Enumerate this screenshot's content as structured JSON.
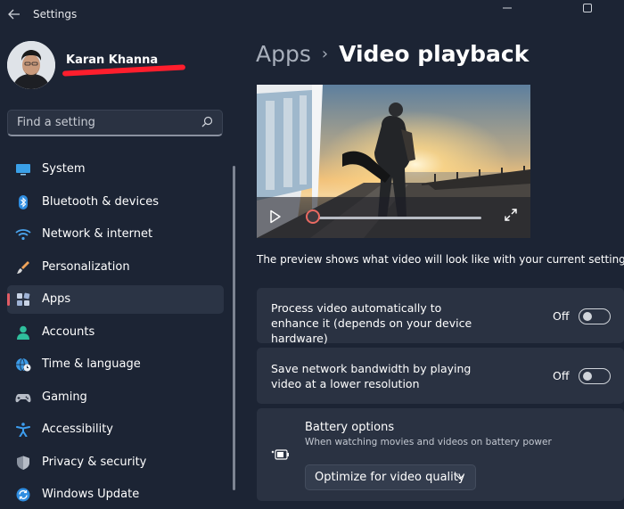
{
  "window": {
    "title": "Settings"
  },
  "profile": {
    "name": "Karan Khanna"
  },
  "search": {
    "placeholder": "Find a setting"
  },
  "sidebar": {
    "items": [
      {
        "label": "System",
        "icon": "monitor-icon",
        "active": false
      },
      {
        "label": "Bluetooth & devices",
        "icon": "bluetooth-icon",
        "active": false
      },
      {
        "label": "Network & internet",
        "icon": "wifi-icon",
        "active": false
      },
      {
        "label": "Personalization",
        "icon": "brush-icon",
        "active": false
      },
      {
        "label": "Apps",
        "icon": "apps-icon",
        "active": true
      },
      {
        "label": "Accounts",
        "icon": "person-icon",
        "active": false
      },
      {
        "label": "Time & language",
        "icon": "globe-clock-icon",
        "active": false
      },
      {
        "label": "Gaming",
        "icon": "controller-icon",
        "active": false
      },
      {
        "label": "Accessibility",
        "icon": "accessibility-icon",
        "active": false
      },
      {
        "label": "Privacy & security",
        "icon": "shield-icon",
        "active": false
      },
      {
        "label": "Windows Update",
        "icon": "update-icon",
        "active": false
      }
    ]
  },
  "breadcrumb": {
    "parent": "Apps",
    "separator": "›",
    "current": "Video playback"
  },
  "preview": {
    "caption": "The preview shows what video will look like with your current settings.",
    "progress": 0.0
  },
  "settings": {
    "enhance": {
      "label": "Process video automatically to enhance it (depends on your device hardware)",
      "state": "Off",
      "on": false
    },
    "bandwidth": {
      "label": "Save network bandwidth by playing video at a lower resolution",
      "state": "Off",
      "on": false
    },
    "battery": {
      "title": "Battery options",
      "subtitle": "When watching movies and videos on battery power",
      "selected": "Optimize for video quality"
    }
  },
  "colors": {
    "background": "#1c2434",
    "card": "#2a3242",
    "accent_indicator": "#e15b64",
    "redaction": "#ff1e2d"
  }
}
